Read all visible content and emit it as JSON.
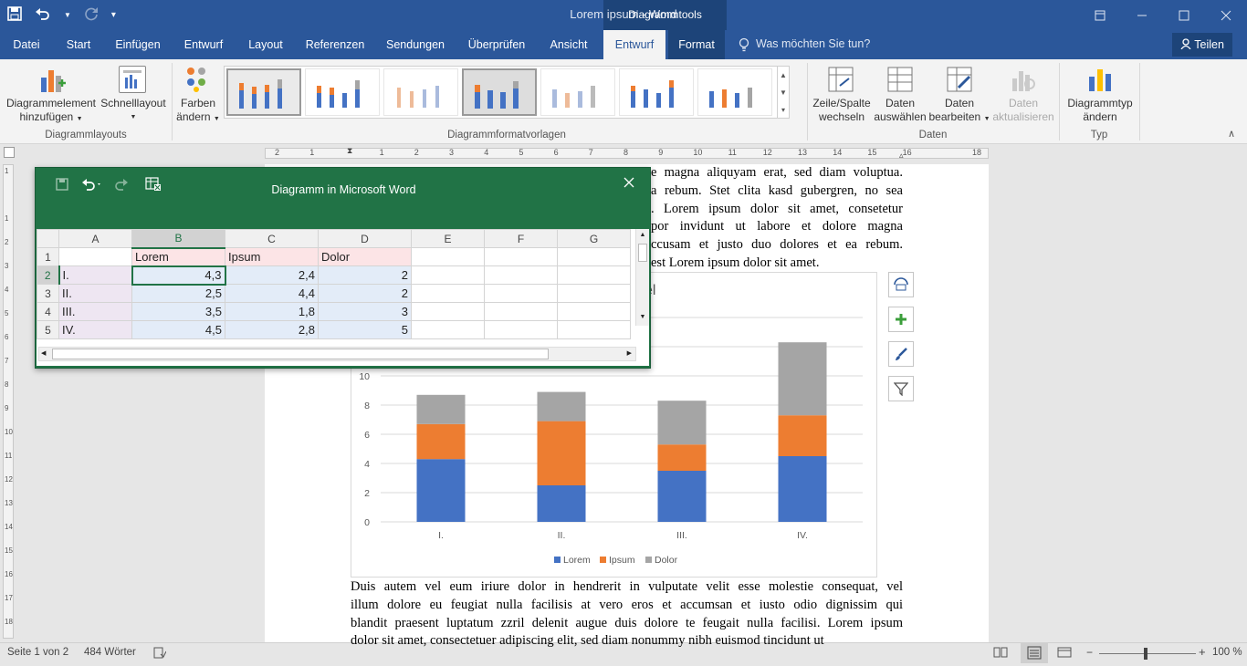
{
  "window": {
    "title": "Lorem ipsum  -  Word",
    "context_group": "Diagrammtools"
  },
  "tabs": [
    "Datei",
    "Start",
    "Einfügen",
    "Entwurf",
    "Layout",
    "Referenzen",
    "Sendungen",
    "Überprüfen",
    "Ansicht",
    "Entwurf",
    "Format"
  ],
  "tell_me": "Was möchten Sie tun?",
  "share": "Teilen",
  "ribbon": {
    "add_element": [
      "Diagrammelement",
      "hinzufügen"
    ],
    "quick_layout": "Schnelllayout",
    "change_colors": [
      "Farben",
      "ändern"
    ],
    "group_layouts": "Diagrammlayouts",
    "group_styles": "Diagrammformatvorlagen",
    "switch_row_col": [
      "Zeile/Spalte",
      "wechseln"
    ],
    "select_data": [
      "Daten",
      "auswählen"
    ],
    "edit_data": [
      "Daten",
      "bearbeiten"
    ],
    "refresh_data": [
      "Daten",
      "aktualisieren"
    ],
    "group_data": "Daten",
    "change_type": [
      "Diagrammtyp",
      "ändern"
    ],
    "group_type": "Typ"
  },
  "ruler_ticks": [
    "2",
    "1",
    "",
    "1",
    "2",
    "3",
    "4",
    "5",
    "6",
    "7",
    "8",
    "9",
    "10",
    "11",
    "12",
    "13",
    "14",
    "15",
    "16",
    "",
    "18"
  ],
  "vruler_ticks": [
    "1",
    "",
    "1",
    "2",
    "3",
    "4",
    "5",
    "6",
    "7",
    "8",
    "9",
    "10",
    "11",
    "12",
    "13",
    "14",
    "15",
    "16",
    "17",
    "18",
    "19"
  ],
  "doc": {
    "para1": [
      "e magna aliquyam erat, sed diam voluptua.",
      "a rebum. Stet clita kasd gubergren, no sea",
      ". Lorem ipsum dolor sit amet, consetetur",
      "por invidunt ut labore et dolore magna",
      "ccusam et justo duo dolores et ea rebum.",
      "est Lorem ipsum dolor sit amet."
    ],
    "para2": [
      "Duis autem vel eum iriure dolor in hendrerit in vulputate velit esse molestie consequat, vel",
      "illum dolore eu feugiat nulla facilisis at vero eros et accumsan et iusto odio dignissim qui",
      "blandit praesent luptatum zzril delenit augue duis dolore te feugait nulla facilisi. Lorem ipsum",
      "dolor sit amet, consectetuer adipiscing elit, sed diam nonummy nibh euismod tincidunt ut"
    ],
    "chart_title_fragment": "el"
  },
  "excel": {
    "title": "Diagramm in Microsoft Word",
    "columns": [
      "A",
      "B",
      "C",
      "D",
      "E",
      "F",
      "G"
    ],
    "rows": [
      {
        "n": "1",
        "cells": [
          "",
          "Lorem",
          "Ipsum",
          "Dolor",
          "",
          "",
          ""
        ]
      },
      {
        "n": "2",
        "cells": [
          "I.",
          "4,3",
          "2,4",
          "2",
          "",
          "",
          ""
        ]
      },
      {
        "n": "3",
        "cells": [
          "II.",
          "2,5",
          "4,4",
          "2",
          "",
          "",
          ""
        ]
      },
      {
        "n": "4",
        "cells": [
          "III.",
          "3,5",
          "1,8",
          "3",
          "",
          "",
          ""
        ]
      },
      {
        "n": "5",
        "cells": [
          "IV.",
          "4,5",
          "2,8",
          "5",
          "",
          "",
          ""
        ]
      }
    ]
  },
  "chart_data": {
    "type": "bar",
    "stacked": true,
    "categories": [
      "I.",
      "II.",
      "III.",
      "IV."
    ],
    "series": [
      {
        "name": "Lorem",
        "values": [
          4.3,
          2.5,
          3.5,
          4.5
        ],
        "color": "#4472c4"
      },
      {
        "name": "Ipsum",
        "values": [
          2.4,
          4.4,
          1.8,
          2.8
        ],
        "color": "#ed7d31"
      },
      {
        "name": "Dolor",
        "values": [
          2,
          2,
          3,
          5
        ],
        "color": "#a5a5a5"
      }
    ],
    "yticks": [
      "0",
      "2",
      "4",
      "6",
      "8",
      "10"
    ],
    "ylim": [
      0,
      14
    ],
    "grid": true,
    "legend_position": "bottom"
  },
  "status": {
    "page": "Seite 1 von 2",
    "words": "484 Wörter",
    "zoom": "100 %"
  }
}
